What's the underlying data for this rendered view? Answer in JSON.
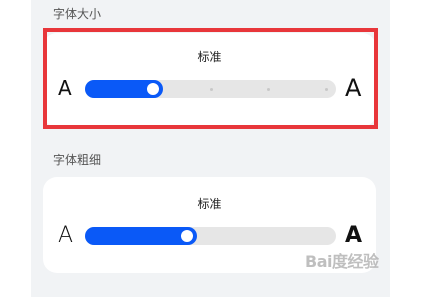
{
  "font_size": {
    "section_label": "字体大小",
    "value_label": "标准",
    "small_glyph": "A",
    "large_glyph": "A",
    "level_fraction": 0.25
  },
  "font_weight": {
    "section_label": "字体粗细",
    "value_label": "标准",
    "thin_glyph": "A",
    "bold_glyph": "A",
    "level_fraction": 0.4
  },
  "colors": {
    "accent": "#0a59f7",
    "highlight": "#e8363a"
  },
  "watermark": "Bai度经验"
}
